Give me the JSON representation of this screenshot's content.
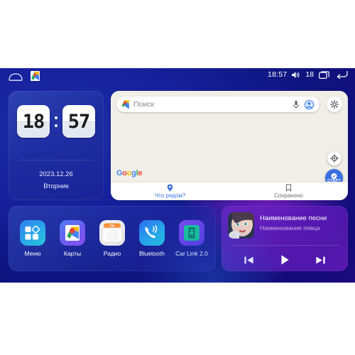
{
  "statusbar": {
    "home_icon": "home-icon",
    "maps_icon": "maps-shortcut-icon",
    "time": "18:57",
    "volume_icon": "volume-icon",
    "volume_level": "18",
    "recents_icon": "recents-icon",
    "back_icon": "back-icon"
  },
  "clock_widget": {
    "hours": "18",
    "minutes": "57",
    "date": "2023.12.26",
    "weekday": "Вторник"
  },
  "maps_widget": {
    "search_placeholder": "Поиск",
    "pin_icon": "maps-pin-icon",
    "mic_icon": "microphone-icon",
    "account_icon": "account-avatar-icon",
    "settings_icon": "gear-icon",
    "compass_icon": "compass-icon",
    "start_button_label": "СТАРТ",
    "google_logo": [
      "G",
      "o",
      "o",
      "g",
      "l",
      "e"
    ],
    "tabs": [
      {
        "label": "Что рядом?",
        "icon": "location-pin-icon",
        "active": true
      },
      {
        "label": "Сохранено",
        "icon": "bookmark-icon",
        "active": false
      }
    ]
  },
  "dock": {
    "apps": [
      {
        "label": "Меню",
        "icon": "apps-grid-icon"
      },
      {
        "label": "Карты",
        "icon": "maps-icon"
      },
      {
        "label": "Радио",
        "icon": "radio-icon",
        "badge": "FM"
      },
      {
        "label": "Bluetooth",
        "icon": "bluetooth-phone-icon"
      },
      {
        "label": "Car Link 2.0",
        "icon": "car-link-icon"
      }
    ]
  },
  "player": {
    "album_art": "album-art-portrait",
    "title": "Наименование песни",
    "artist": "Наименование певца",
    "controls": [
      {
        "name": "previous-track-button",
        "icon": "skip-previous-icon"
      },
      {
        "name": "play-button",
        "icon": "play-icon"
      },
      {
        "name": "next-track-button",
        "icon": "skip-next-icon"
      }
    ]
  },
  "colors": {
    "bg_blue": "#141a96",
    "bg_purple": "#7a12b8",
    "map_bg": "#f1eee7",
    "accent_blue": "#3b6fe0",
    "google_blue": "#4285F4"
  }
}
